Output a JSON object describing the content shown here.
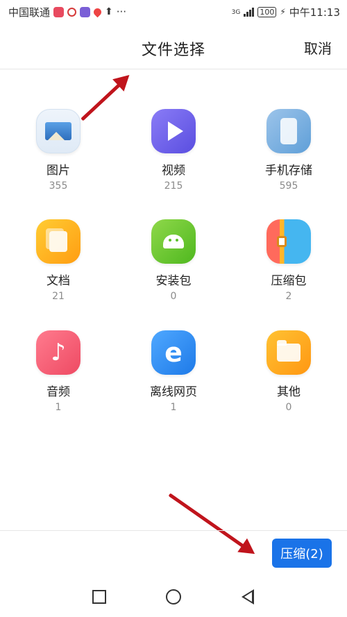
{
  "status_bar": {
    "carrier": "中国联通",
    "network": "3G",
    "battery": "100",
    "time": "中午11:13",
    "more": "···"
  },
  "header": {
    "title": "文件选择",
    "cancel_label": "取消"
  },
  "categories": [
    {
      "label": "图片",
      "count": "355",
      "icon": "image-icon"
    },
    {
      "label": "视频",
      "count": "215",
      "icon": "video-icon"
    },
    {
      "label": "手机存储",
      "count": "595",
      "icon": "phone-storage-icon"
    },
    {
      "label": "文档",
      "count": "21",
      "icon": "document-icon"
    },
    {
      "label": "安装包",
      "count": "0",
      "icon": "android-package-icon"
    },
    {
      "label": "压缩包",
      "count": "2",
      "icon": "archive-icon"
    },
    {
      "label": "音频",
      "count": "1",
      "icon": "music-note-icon"
    },
    {
      "label": "离线网页",
      "count": "1",
      "icon": "offline-web-icon"
    },
    {
      "label": "其他",
      "count": "0",
      "icon": "folder-icon"
    }
  ],
  "actions": {
    "compress_label": "压缩(2)"
  },
  "colors": {
    "accent": "#1a73e8",
    "annotation_arrow": "#c0141c"
  }
}
